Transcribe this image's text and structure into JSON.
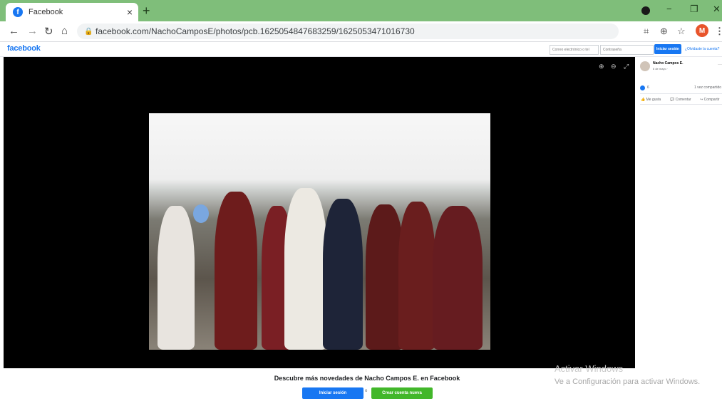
{
  "browser": {
    "tab_title": "Facebook",
    "tab_close": "×",
    "new_tab": "+",
    "url": "facebook.com/NachoCamposE/photos/pcb.1625054847683259/1625053471016730",
    "profile_initial": "M",
    "window_controls": [
      "−",
      "❐",
      "✕"
    ],
    "icons": [
      "back-icon",
      "forward-icon",
      "reload-icon",
      "home-icon",
      "lock-icon",
      "qr-icon",
      "zoom-icon",
      "star-icon",
      "menu-icon"
    ]
  },
  "fb_header": {
    "logo": "facebook",
    "email_placeholder": "Correo electrónico o tel",
    "password_placeholder": "Contraseña",
    "login_button": "Iniciar sesión",
    "forgot_link": "¿Olvidaste la cuenta?"
  },
  "side_panel": {
    "author": "Nacho Campos E.",
    "date": "6 de mayo · ",
    "reactions_count": "6",
    "shares": "1 vez compartido",
    "actions": [
      "Me gusta",
      "Comentar",
      "Compartir"
    ]
  },
  "banner": {
    "title": "Descubre más novedades de Nacho Campos E. en Facebook",
    "login_button": "Iniciar sesión",
    "separator": "o",
    "create_button": "Crear cuenta nueva"
  },
  "watermark": {
    "line1": "Activar Windows",
    "line2": "Ve a Configuración para activar Windows."
  },
  "colors": {
    "tab_strip": "#7fbe7a",
    "fb_blue": "#1877f2",
    "create_green": "#42b72a"
  }
}
